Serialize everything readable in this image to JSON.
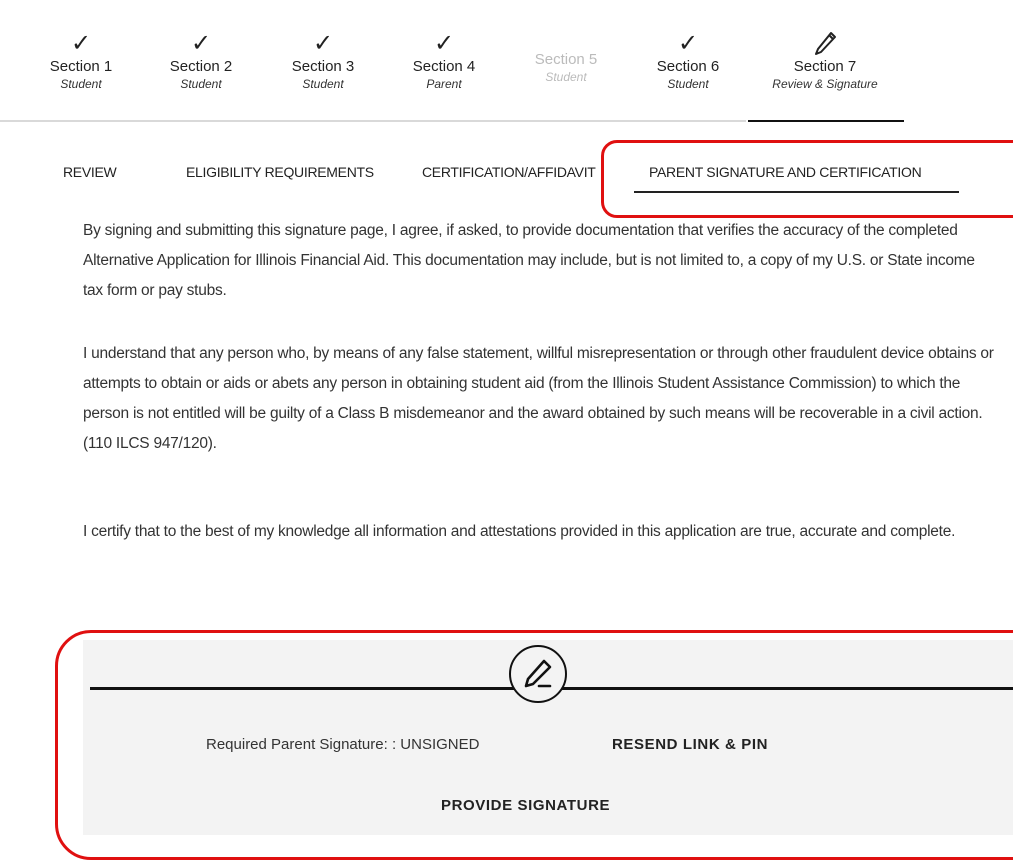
{
  "stepper": {
    "steps": [
      {
        "title": "Section 1",
        "sub": "Student",
        "status": "complete"
      },
      {
        "title": "Section 2",
        "sub": "Student",
        "status": "complete"
      },
      {
        "title": "Section 3",
        "sub": "Student",
        "status": "complete"
      },
      {
        "title": "Section 4",
        "sub": "Parent",
        "status": "complete"
      },
      {
        "title": "Section 5",
        "sub": "Student",
        "status": "disabled"
      },
      {
        "title": "Section 6",
        "sub": "Student",
        "status": "complete"
      },
      {
        "title": "Section 7",
        "sub": "Review & Signature",
        "status": "current"
      }
    ],
    "check_glyph": "✓"
  },
  "tabs": [
    {
      "label": "REVIEW"
    },
    {
      "label": "ELIGIBILITY REQUIREMENTS"
    },
    {
      "label": "CERTIFICATION/AFFIDAVIT"
    },
    {
      "label": "PARENT SIGNATURE AND CERTIFICATION",
      "active": true
    }
  ],
  "body": {
    "paragraph_1": "By signing and submitting this signature page, I agree, if asked, to provide documentation that verifies the accuracy of the completed Alternative Application for Illinois Financial Aid.  This documentation may include, but is not limited to, a copy of my U.S. or State income tax form or pay stubs.",
    "paragraph_2": "I understand that any person who, by means of any false statement, willful misrepresentation or through other fraudulent device obtains or attempts to obtain or aids or abets any person in obtaining student aid (from the Illinois Student Assistance Commission) to which the person is not entitled will be guilty of a Class B misdemeanor and the award obtained by such means will be recoverable in a civil action. (110 ILCS 947/120).",
    "paragraph_3": "I certify that to the best of my knowledge all information and attestations provided in this application are true, accurate and complete."
  },
  "signature": {
    "icon": "signature-pen-icon",
    "label": "Required Parent Signature: : UNSIGNED",
    "resend_label": "RESEND LINK & PIN",
    "provide_label": "PROVIDE SIGNATURE"
  },
  "colors": {
    "highlight": "#e01010",
    "panel_bg": "#f3f3f3",
    "disabled_text": "#bbbbbb"
  }
}
